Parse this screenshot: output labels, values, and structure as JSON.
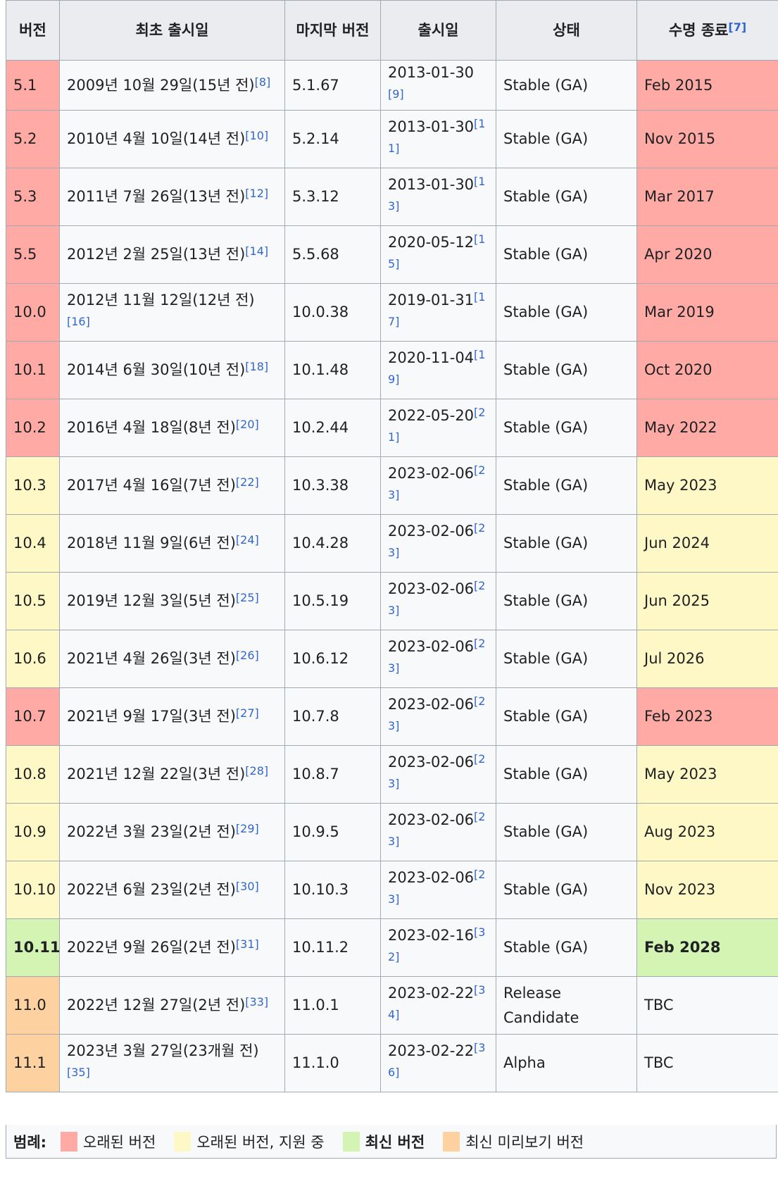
{
  "headers": {
    "version": "버전",
    "initial_release": "최초 출시일",
    "latest_version": "마지막 버전",
    "release_date": "출시일",
    "status": "상태",
    "eol": "수명 종료",
    "eol_ref": "[7]"
  },
  "colors": {
    "old": "#ffaaa5",
    "supported": "#fef8c6",
    "current": "#d4f4b4",
    "preview": "#fed1a0"
  },
  "rows": [
    {
      "version": "5.1",
      "initial": "2009년 10월 29일(15년 전)",
      "initial_ref": "[8]",
      "latest": "5.1.67",
      "date": "2013-01-30",
      "date_ref": "[9]",
      "status": "Stable (GA)",
      "eol": "Feb 2015",
      "kind": "old"
    },
    {
      "version": "5.2",
      "initial": "2010년 4월 10일(14년 전)",
      "initial_ref": "[10]",
      "latest": "5.2.14",
      "date": "2013-01-30",
      "date_ref": "[11]",
      "status": "Stable (GA)",
      "eol": "Nov 2015",
      "kind": "old"
    },
    {
      "version": "5.3",
      "initial": "2011년 7월 26일(13년 전)",
      "initial_ref": "[12]",
      "latest": "5.3.12",
      "date": "2013-01-30",
      "date_ref": "[13]",
      "status": "Stable (GA)",
      "eol": "Mar 2017",
      "kind": "old"
    },
    {
      "version": "5.5",
      "initial": "2012년 2월 25일(13년 전)",
      "initial_ref": "[14]",
      "latest": "5.5.68",
      "date": "2020-05-12",
      "date_ref": "[15]",
      "status": "Stable (GA)",
      "eol": "Apr 2020",
      "kind": "old"
    },
    {
      "version": "10.0",
      "initial": "2012년 11월 12일(12년 전)",
      "initial_ref": "[16]",
      "latest": "10.0.38",
      "date": "2019-01-31",
      "date_ref": "[17]",
      "status": "Stable (GA)",
      "eol": "Mar 2019",
      "kind": "old"
    },
    {
      "version": "10.1",
      "initial": "2014년 6월 30일(10년 전)",
      "initial_ref": "[18]",
      "latest": "10.1.48",
      "date": "2020-11-04",
      "date_ref": "[19]",
      "status": "Stable (GA)",
      "eol": "Oct 2020",
      "kind": "old"
    },
    {
      "version": "10.2",
      "initial": "2016년 4월 18일(8년 전)",
      "initial_ref": "[20]",
      "latest": "10.2.44",
      "date": "2022-05-20",
      "date_ref": "[21]",
      "status": "Stable (GA)",
      "eol": "May 2022",
      "kind": "old"
    },
    {
      "version": "10.3",
      "initial": "2017년 4월 16일(7년 전)",
      "initial_ref": "[22]",
      "latest": "10.3.38",
      "date": "2023-02-06",
      "date_ref": "[23]",
      "status": "Stable (GA)",
      "eol": "May 2023",
      "kind": "sup"
    },
    {
      "version": "10.4",
      "initial": "2018년 11월 9일(6년 전)",
      "initial_ref": "[24]",
      "latest": "10.4.28",
      "date": "2023-02-06",
      "date_ref": "[23]",
      "status": "Stable (GA)",
      "eol": "Jun 2024",
      "kind": "sup"
    },
    {
      "version": "10.5",
      "initial": "2019년 12월 3일(5년 전)",
      "initial_ref": "[25]",
      "latest": "10.5.19",
      "date": "2023-02-06",
      "date_ref": "[23]",
      "status": "Stable (GA)",
      "eol": "Jun 2025",
      "kind": "sup"
    },
    {
      "version": "10.6",
      "initial": "2021년 4월 26일(3년 전)",
      "initial_ref": "[26]",
      "latest": "10.6.12",
      "date": "2023-02-06",
      "date_ref": "[23]",
      "status": "Stable (GA)",
      "eol": "Jul 2026",
      "kind": "sup"
    },
    {
      "version": "10.7",
      "initial": "2021년 9월 17일(3년 전)",
      "initial_ref": "[27]",
      "latest": "10.7.8",
      "date": "2023-02-06",
      "date_ref": "[23]",
      "status": "Stable (GA)",
      "eol": "Feb 2023",
      "kind": "old"
    },
    {
      "version": "10.8",
      "initial": "2021년 12월 22일(3년 전)",
      "initial_ref": "[28]",
      "latest": "10.8.7",
      "date": "2023-02-06",
      "date_ref": "[23]",
      "status": "Stable (GA)",
      "eol": "May 2023",
      "kind": "sup"
    },
    {
      "version": "10.9",
      "initial": "2022년 3월 23일(2년 전)",
      "initial_ref": "[29]",
      "latest": "10.9.5",
      "date": "2023-02-06",
      "date_ref": "[23]",
      "status": "Stable (GA)",
      "eol": "Aug 2023",
      "kind": "sup"
    },
    {
      "version": "10.10",
      "initial": "2022년 6월 23일(2년 전)",
      "initial_ref": "[30]",
      "latest": "10.10.3",
      "date": "2023-02-06",
      "date_ref": "[23]",
      "status": "Stable (GA)",
      "eol": "Nov 2023",
      "kind": "sup"
    },
    {
      "version": "10.11",
      "initial": "2022년 9월 26일(2년 전)",
      "initial_ref": "[31]",
      "latest": "10.11.2",
      "date": "2023-02-16",
      "date_ref": "[32]",
      "status": "Stable (GA)",
      "eol": "Feb 2028",
      "kind": "cur"
    },
    {
      "version": "11.0",
      "initial": "2022년 12월 27일(2년 전)",
      "initial_ref": "[33]",
      "latest": "11.0.1",
      "date": "2023-02-22",
      "date_ref": "[34]",
      "status": "Release Candidate",
      "eol": "TBC",
      "kind": "pre"
    },
    {
      "version": "11.1",
      "initial": "2023년 3월 27일(23개월 전)",
      "initial_ref": "[35]",
      "latest": "11.1.0",
      "date": "2023-02-22",
      "date_ref": "[36]",
      "status": "Alpha",
      "eol": "TBC",
      "kind": "pre"
    }
  ],
  "legend": {
    "label": "범례:",
    "old": "오래된 버전",
    "supported": "오래된 버전, 지원 중",
    "current": "최신 버전",
    "preview": "최신 미리보기 버전"
  }
}
